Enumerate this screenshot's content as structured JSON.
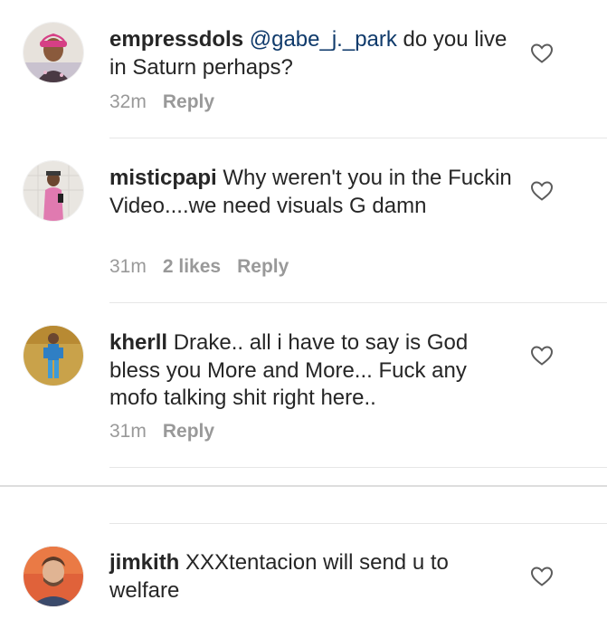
{
  "comments": [
    {
      "username": "empressdols",
      "mention": "@gabe_j._park",
      "text": " do you live in Saturn perhaps?",
      "time": "32m",
      "likes": "",
      "reply": "Reply",
      "avatar_icon": "user-avatar-empressdols"
    },
    {
      "username": "misticpapi",
      "mention": "",
      "text": " Why weren't you in the Fuckin Video....we need visuals G damn",
      "time": "31m",
      "likes": "2 likes",
      "reply": "Reply",
      "avatar_icon": "user-avatar-misticpapi"
    },
    {
      "username": "kherll",
      "mention": "",
      "text": " Drake.. all i have to say is God bless you More and More... Fuck any mofo talking shit right here..",
      "time": "31m",
      "likes": "",
      "reply": "Reply",
      "avatar_icon": "user-avatar-kherll"
    },
    {
      "username": "jimkith",
      "mention": "",
      "text": " XXXtentacion will send u to welfare",
      "time": "",
      "likes": "",
      "reply": "",
      "avatar_icon": "user-avatar-jimkith"
    }
  ],
  "colors": {
    "text": "#262626",
    "meta": "#999999",
    "mention": "#0f3a6b",
    "divider": "#e6e6e6"
  }
}
